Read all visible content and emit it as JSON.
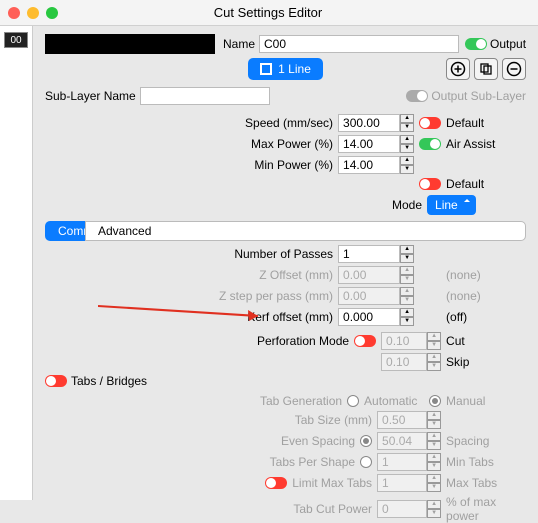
{
  "title": "Cut Settings Editor",
  "left_swatch": "00",
  "name_label": "Name",
  "name_value": "C00",
  "output_label": "Output",
  "line_tab": "1 Line",
  "sublayer_label": "Sub-Layer Name",
  "sublayer_value": "",
  "output_sublayer_label": "Output Sub-Layer",
  "speed": {
    "label": "Speed (mm/sec)",
    "value": "300.00",
    "tail": "Default"
  },
  "maxp": {
    "label": "Max Power (%)",
    "value": "14.00",
    "tail": "Air Assist"
  },
  "minp": {
    "label": "Min Power (%)",
    "value": "14.00"
  },
  "default2": "Default",
  "mode_label": "Mode",
  "mode_value": "Line",
  "common": "Common",
  "advanced": "Advanced",
  "passes": {
    "label": "Number of Passes",
    "value": "1"
  },
  "zoff": {
    "label": "Z Offset (mm)",
    "value": "0.00",
    "tail": "(none)"
  },
  "zstep": {
    "label": "Z step per pass (mm)",
    "value": "0.00",
    "tail": "(none)"
  },
  "kerf": {
    "label": "Kerf offset (mm)",
    "value": "0.000",
    "tail": "(off)"
  },
  "perf_label": "Perforation Mode",
  "perf_cut": {
    "value": "0.10",
    "label": "Cut"
  },
  "perf_skip": {
    "value": "0.10",
    "label": "Skip"
  },
  "tabs_label": "Tabs / Bridges",
  "tabgen": {
    "label": "Tab Generation",
    "auto": "Automatic",
    "manual": "Manual"
  },
  "tabsize": {
    "label": "Tab Size (mm)",
    "value": "0.50"
  },
  "even": {
    "label": "Even Spacing",
    "value": "50.04",
    "tail": "Spacing"
  },
  "tps": {
    "label": "Tabs Per Shape",
    "value": "1",
    "tail": "Min Tabs"
  },
  "limit": {
    "label": "Limit Max Tabs",
    "value": "1",
    "tail": "Max Tabs"
  },
  "cutpow": {
    "label": "Tab Cut Power",
    "value": "0",
    "tail": "% of max power"
  }
}
